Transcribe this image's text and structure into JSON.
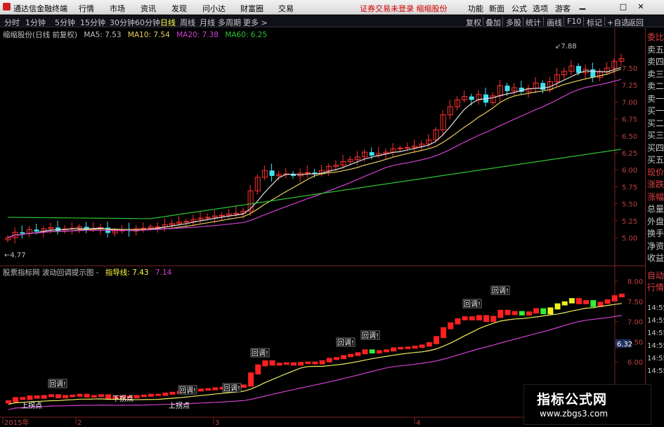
{
  "menubar": {
    "app_title": "通达信金融终端",
    "menus": [
      "行情",
      "市场",
      "资讯",
      "发现",
      "问小达",
      "财富圈",
      "交易"
    ],
    "warning": "证券交易未登录  缩缩股份",
    "right_menus": [
      "功能",
      "新面",
      "公式",
      "选项"
    ],
    "guest": "游客",
    "window_buttons": [
      "▁",
      "□",
      "✕"
    ]
  },
  "tabbar": {
    "periods": [
      "分时",
      "1分钟",
      "5分钟",
      "15分钟",
      "30分钟",
      "60分钟",
      "日线",
      "周线",
      "月线",
      "多周期",
      "更多 >"
    ],
    "active_period": "日线",
    "right_buttons": [
      "复权",
      "叠加",
      "多股",
      "统计",
      "画线",
      "F10",
      "标记",
      "+自选",
      "返回"
    ]
  },
  "main_legend": {
    "stock": "缩缩股份(日线 前复权)",
    "ma5": "MA5: 7.53",
    "ma10": "MA10: 7.54",
    "ma20": "MA20: 7.38",
    "ma60": "MA60: 6.25",
    "colors": {
      "ma5": "#e0e0e0",
      "ma10": "#e8d060",
      "ma20": "#d040d0",
      "ma60": "#30c030"
    }
  },
  "main_axis": {
    "ticks": [
      "7.50",
      "7.25",
      "7.00",
      "6.75",
      "6.50",
      "6.25",
      "6.00",
      "5.75",
      "5.50",
      "5.25",
      "5.00"
    ],
    "high_label": "7.88",
    "low_label": "4.77"
  },
  "indicator_legend": {
    "title": "股票指标网  波动回调提示图 -",
    "guide_label": "指导线: 7.43",
    "line2_label": "7.14"
  },
  "indicator_axis": {
    "ticks": [
      "8.00",
      "7.50",
      "7.00",
      "6.50",
      "6.00"
    ],
    "current": "6.32"
  },
  "indicator_annotations": {
    "pullback": "回调!",
    "turn_up": "上拐点",
    "turn_down": "下拐点"
  },
  "time_axis": [
    "2015年",
    "2",
    "3",
    "4"
  ],
  "right_panel": {
    "items": [
      "委比",
      "卖五",
      "卖四",
      "卖三",
      "卖二",
      "卖一",
      "买一",
      "买二",
      "买三",
      "买四",
      "买五",
      "现价",
      "涨跌",
      "涨幅",
      "总量",
      "外盘",
      "换手",
      "净资",
      "收益"
    ],
    "bottom_items": [
      "自动",
      "行情"
    ],
    "times": [
      "14:55",
      "14:55",
      "14:55",
      "14:55",
      "14:55",
      "14:55"
    ]
  },
  "watermark": {
    "line1": "指标公式网",
    "line2": "www.zbgs3.com"
  }
}
